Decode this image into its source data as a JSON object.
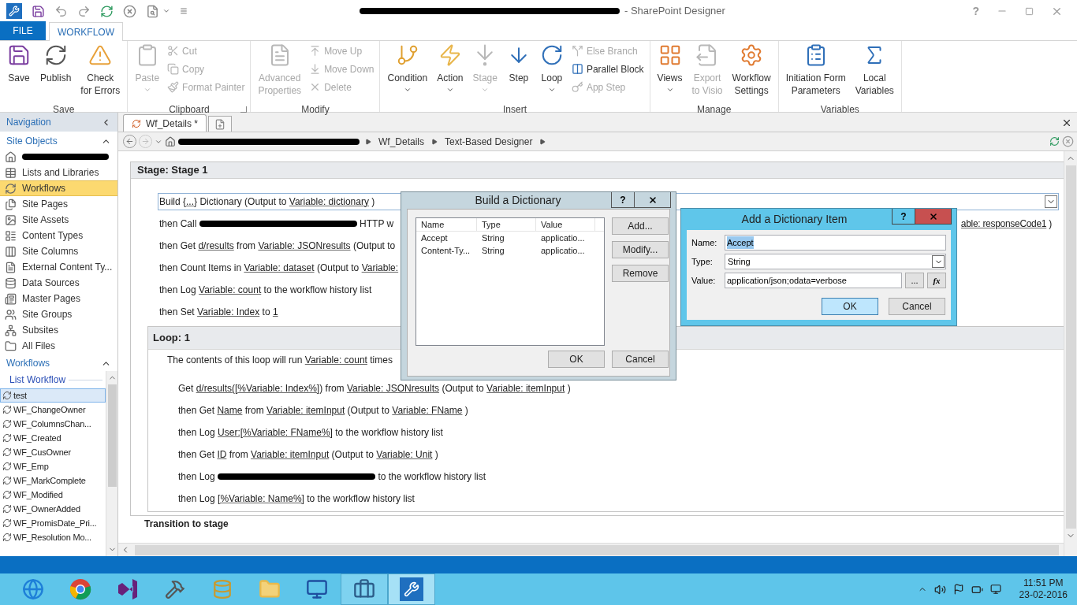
{
  "window": {
    "title": "- SharePoint Designer",
    "help": "?"
  },
  "ribbon": {
    "tabs": [
      {
        "label": "FILE",
        "kind": "file",
        "selected": false
      },
      {
        "label": "WORKFLOW",
        "kind": "tab",
        "selected": true
      }
    ],
    "groups": [
      {
        "label": "Save",
        "buttons": [
          {
            "label": "Save",
            "kind": "large",
            "disabled": false,
            "dropdown": false
          },
          {
            "label": "Publish",
            "kind": "large",
            "disabled": false,
            "dropdown": false
          },
          {
            "label": "Check\nfor Errors",
            "kind": "large",
            "disabled": false,
            "dropdown": false
          }
        ]
      },
      {
        "label": "Clipboard",
        "launcher": true,
        "buttons": [
          {
            "label": "Paste",
            "kind": "large",
            "disabled": true,
            "dropdown": true
          },
          {
            "label": "Cut",
            "kind": "small",
            "disabled": true,
            "dropdown": false
          },
          {
            "label": "Copy",
            "kind": "small",
            "disabled": true,
            "dropdown": false
          },
          {
            "label": "Format Painter",
            "kind": "small",
            "disabled": true,
            "dropdown": false
          }
        ]
      },
      {
        "label": "Modify",
        "buttons": [
          {
            "label": "Advanced\nProperties",
            "kind": "large",
            "disabled": true,
            "dropdown": false
          },
          {
            "label": "Move Up",
            "kind": "small",
            "disabled": true,
            "dropdown": false
          },
          {
            "label": "Move Down",
            "kind": "small",
            "disabled": true,
            "dropdown": false
          },
          {
            "label": "Delete",
            "kind": "small",
            "disabled": true,
            "dropdown": false
          }
        ]
      },
      {
        "label": "Insert",
        "buttons": [
          {
            "label": "Condition",
            "kind": "large",
            "disabled": false,
            "dropdown": true
          },
          {
            "label": "Action",
            "kind": "large",
            "disabled": false,
            "dropdown": true
          },
          {
            "label": "Stage",
            "kind": "large",
            "disabled": true,
            "dropdown": true
          },
          {
            "label": "Step",
            "kind": "large",
            "disabled": false,
            "dropdown": false
          },
          {
            "label": "Loop",
            "kind": "large",
            "disabled": false,
            "dropdown": true
          },
          {
            "label": "Else Branch",
            "kind": "small",
            "disabled": true,
            "dropdown": false
          },
          {
            "label": "Parallel Block",
            "kind": "small",
            "disabled": false,
            "dropdown": false
          },
          {
            "label": "App Step",
            "kind": "small",
            "disabled": true,
            "dropdown": false
          }
        ]
      },
      {
        "label": "Manage",
        "buttons": [
          {
            "label": "Views",
            "kind": "large",
            "disabled": false,
            "dropdown": true
          },
          {
            "label": "Export\nto Visio",
            "kind": "large",
            "disabled": true,
            "dropdown": false
          },
          {
            "label": "Workflow\nSettings",
            "kind": "large",
            "disabled": false,
            "dropdown": false
          }
        ]
      },
      {
        "label": "Variables",
        "buttons": [
          {
            "label": "Initiation Form\nParameters",
            "kind": "large",
            "disabled": false,
            "dropdown": false
          },
          {
            "label": "Local\nVariables",
            "kind": "large",
            "disabled": false,
            "dropdown": false
          }
        ]
      }
    ]
  },
  "navigation": {
    "title": "Navigation",
    "sections": [
      {
        "title": "Site Objects",
        "expanded": true,
        "items": [
          {
            "kind": "redacted",
            "selected": false
          },
          {
            "kind": "item",
            "label": "Lists and Libraries",
            "selected": false
          },
          {
            "kind": "item",
            "label": "Workflows",
            "selected": true
          },
          {
            "kind": "item",
            "label": "Site Pages",
            "selected": false
          },
          {
            "kind": "item",
            "label": "Site Assets",
            "selected": false
          },
          {
            "kind": "item",
            "label": "Content Types",
            "selected": false
          },
          {
            "kind": "item",
            "label": "Site Columns",
            "selected": false
          },
          {
            "kind": "item",
            "label": "External Content Ty...",
            "selected": false
          },
          {
            "kind": "item",
            "label": "Data Sources",
            "selected": false
          },
          {
            "kind": "item",
            "label": "Master Pages",
            "selected": false
          },
          {
            "kind": "item",
            "label": "Site Groups",
            "selected": false
          },
          {
            "kind": "item",
            "label": "Subsites",
            "selected": false
          },
          {
            "kind": "item",
            "label": "All Files",
            "selected": false
          }
        ]
      },
      {
        "title": "Workflows",
        "expanded": true,
        "subheader": "List Workflow",
        "workflows": [
          {
            "label": "test",
            "selected": true
          },
          {
            "label": "WF_ChangeOwner",
            "selected": false
          },
          {
            "label": "WF_ColumnsChan...",
            "selected": false
          },
          {
            "label": "WF_Created",
            "selected": false
          },
          {
            "label": "WF_CusOwner",
            "selected": false
          },
          {
            "label": "WF_Emp",
            "selected": false
          },
          {
            "label": "WF_MarkComplete",
            "selected": false
          },
          {
            "label": "WF_Modified",
            "selected": false
          },
          {
            "label": "WF_OwnerAdded",
            "selected": false
          },
          {
            "label": "WF_PromisDate_Pri...",
            "selected": false
          },
          {
            "label": "WF_Resolution Mo...",
            "selected": false
          }
        ]
      }
    ]
  },
  "editor": {
    "tabs": [
      {
        "label": "Wf_Details *",
        "selected": true
      }
    ],
    "breadcrumb": [
      "Wf_Details",
      "Text-Based Designer"
    ],
    "stage": {
      "title": "Stage: Stage 1",
      "steps": [
        {
          "selected": true,
          "segments": [
            {
              "kind": "plain",
              "text": "Build"
            },
            {
              "kind": "link",
              "text": "{...}"
            },
            {
              "kind": "plain",
              "text": "Dictionary (Output to"
            },
            {
              "kind": "link",
              "text": "Variable: dictionary"
            },
            {
              "kind": "plain",
              "text": ")"
            }
          ]
        },
        {
          "selected": false,
          "segments": [
            {
              "kind": "plain",
              "text": "then Call"
            },
            {
              "kind": "redacted"
            },
            {
              "kind": "plain",
              "text": "HTTP w"
            }
          ],
          "tail": [
            {
              "kind": "link",
              "text": "able: responseCode1"
            },
            {
              "kind": "plain",
              "text": ")"
            }
          ]
        },
        {
          "selected": false,
          "segments": [
            {
              "kind": "plain",
              "text": "then Get"
            },
            {
              "kind": "link",
              "text": "d/results"
            },
            {
              "kind": "plain",
              "text": "from"
            },
            {
              "kind": "link",
              "text": "Variable: JSONresults"
            },
            {
              "kind": "plain",
              "text": "(Output to"
            }
          ]
        },
        {
          "selected": false,
          "segments": [
            {
              "kind": "plain",
              "text": "then Count Items in"
            },
            {
              "kind": "link",
              "text": "Variable: dataset"
            },
            {
              "kind": "plain",
              "text": "(Output to"
            },
            {
              "kind": "link",
              "text": "Variable:"
            }
          ]
        },
        {
          "selected": false,
          "segments": [
            {
              "kind": "plain",
              "text": "then Log"
            },
            {
              "kind": "link",
              "text": "Variable: count"
            },
            {
              "kind": "plain",
              "text": "to the workflow history list"
            }
          ]
        },
        {
          "selected": false,
          "segments": [
            {
              "kind": "plain",
              "text": "then Set"
            },
            {
              "kind": "link",
              "text": "Variable: Index"
            },
            {
              "kind": "plain",
              "text": "to"
            },
            {
              "kind": "link",
              "text": "1"
            }
          ]
        }
      ],
      "loop": {
        "title": "Loop: 1",
        "intro": [
          {
            "kind": "plain",
            "text": "The contents of this loop will run"
          },
          {
            "kind": "link",
            "text": "Variable: count"
          },
          {
            "kind": "plain",
            "text": "times"
          }
        ],
        "steps": [
          {
            "selected": false,
            "segments": [
              {
                "kind": "plain",
                "text": "Get"
              },
              {
                "kind": "link",
                "text": "d/results([%Variable: Index%])"
              },
              {
                "kind": "plain",
                "text": "from"
              },
              {
                "kind": "link",
                "text": "Variable: JSONresults"
              },
              {
                "kind": "plain",
                "text": "(Output to"
              },
              {
                "kind": "link",
                "text": "Variable: itemInput"
              },
              {
                "kind": "plain",
                "text": ")"
              }
            ]
          },
          {
            "selected": false,
            "segments": [
              {
                "kind": "plain",
                "text": "then Get"
              },
              {
                "kind": "link",
                "text": "Name"
              },
              {
                "kind": "plain",
                "text": "from"
              },
              {
                "kind": "link",
                "text": "Variable: itemInput"
              },
              {
                "kind": "plain",
                "text": "(Output to"
              },
              {
                "kind": "link",
                "text": "Variable: FName"
              },
              {
                "kind": "plain",
                "text": ")"
              }
            ]
          },
          {
            "selected": false,
            "segments": [
              {
                "kind": "plain",
                "text": "then Log"
              },
              {
                "kind": "link",
                "text": "User:[%Variable: FName%]"
              },
              {
                "kind": "plain",
                "text": "to the workflow history list"
              }
            ]
          },
          {
            "selected": false,
            "segments": [
              {
                "kind": "plain",
                "text": "then Get"
              },
              {
                "kind": "link",
                "text": "ID"
              },
              {
                "kind": "plain",
                "text": "from"
              },
              {
                "kind": "link",
                "text": "Variable: itemInput"
              },
              {
                "kind": "plain",
                "text": "(Output to"
              },
              {
                "kind": "link",
                "text": "Variable: Unit"
              },
              {
                "kind": "plain",
                "text": ")"
              }
            ]
          },
          {
            "selected": false,
            "segments": [
              {
                "kind": "plain",
                "text": "then Log"
              },
              {
                "kind": "redacted"
              },
              {
                "kind": "plain",
                "text": "to the workflow history list"
              }
            ]
          },
          {
            "selected": false,
            "segments": [
              {
                "kind": "plain",
                "text": "then Log"
              },
              {
                "kind": "link",
                "text": "[%Variable: Name%]"
              },
              {
                "kind": "plain",
                "text": "to the workflow history list"
              }
            ]
          }
        ]
      },
      "transition": "Transition to stage"
    }
  },
  "build_dialog": {
    "title": "Build a Dictionary",
    "help": "?",
    "columns": [
      "Name",
      "Type",
      "Value"
    ],
    "rows": [
      [
        "Accept",
        "String",
        "applicatio..."
      ],
      [
        "Content-Ty...",
        "String",
        "applicatio..."
      ]
    ],
    "side_buttons": [
      "Add...",
      "Modify...",
      "Remove"
    ],
    "buttons": [
      "OK",
      "Cancel"
    ]
  },
  "item_dialog": {
    "title": "Add a Dictionary Item",
    "help": "?",
    "fields": [
      {
        "label": "Name:",
        "kind": "text",
        "value": "Accept",
        "highlighted": true
      },
      {
        "label": "Type:",
        "kind": "select",
        "value": "String",
        "highlighted": false
      },
      {
        "label": "Value:",
        "kind": "expression",
        "value": "application/json;odata=verbose",
        "highlighted": false,
        "button": "...",
        "function_button": "fx"
      }
    ],
    "buttons": [
      {
        "label": "OK",
        "selected": true
      },
      {
        "label": "Cancel",
        "selected": false
      }
    ]
  },
  "taskbar": {
    "apps": [
      {
        "kind": "ie",
        "open": false,
        "selected": false
      },
      {
        "kind": "chrome",
        "open": false,
        "selected": false
      },
      {
        "kind": "vs",
        "open": false,
        "selected": false
      },
      {
        "kind": "tools",
        "open": false,
        "selected": false
      },
      {
        "kind": "dbtools",
        "open": false,
        "selected": false
      },
      {
        "kind": "explorer",
        "open": false,
        "selected": false
      },
      {
        "kind": "remote",
        "open": false,
        "selected": false
      },
      {
        "kind": "briefcase",
        "open": true,
        "selected": false
      },
      {
        "kind": "spd",
        "open": true,
        "selected": true
      }
    ],
    "clock": {
      "time": "11:51 PM",
      "date": "23-02-2016"
    }
  }
}
